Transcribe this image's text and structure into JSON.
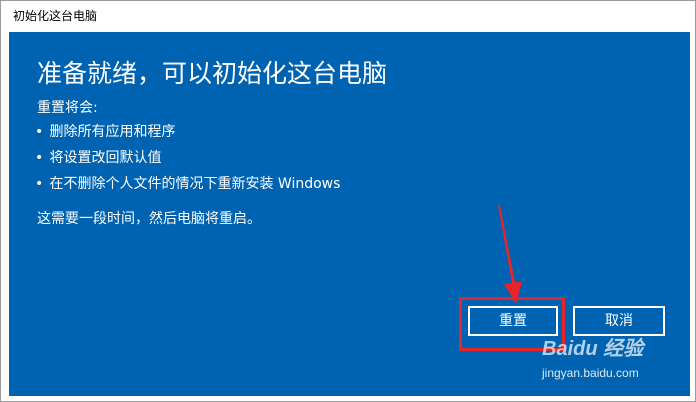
{
  "window": {
    "title": "初始化这台电脑"
  },
  "dialog": {
    "heading": "准备就绪，可以初始化这台电脑",
    "intro": "重置将会:",
    "bullets": [
      "删除所有应用和程序",
      "将设置改回默认值",
      "在不删除个人文件的情况下重新安装 Windows"
    ],
    "bullet_mark": "•",
    "note": "这需要一段时间，然后电脑将重启。"
  },
  "buttons": {
    "reset_label": "重置",
    "cancel_label": "取消"
  },
  "watermark": {
    "logo": "Baidu 经验",
    "url": "jingyan.baidu.com"
  },
  "colors": {
    "dialog_bg": "#0063b1",
    "annotation": "#e6242b"
  }
}
